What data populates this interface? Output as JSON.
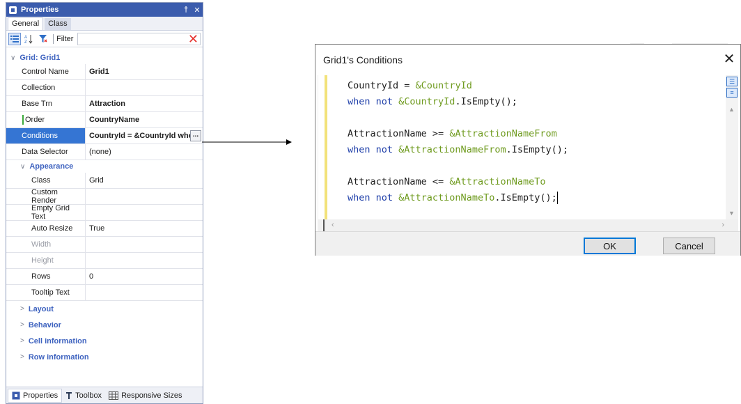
{
  "properties_panel": {
    "title": "Properties",
    "title_buttons": [
      "pin-icon",
      "close-icon"
    ],
    "pin_glyph": "†",
    "close_glyph": "✕",
    "tabs": [
      {
        "label": "General"
      },
      {
        "label": "Class"
      }
    ],
    "filter_label": "Filter",
    "filter_value": "",
    "group_title": "Grid: Grid1",
    "rows": [
      {
        "key": "Control Name",
        "value": "Grid1"
      },
      {
        "key": "Collection",
        "value": ""
      },
      {
        "key": "Base Trn",
        "value": "Attraction"
      },
      {
        "key": "Order",
        "value": "CountryName"
      },
      {
        "key": "Conditions",
        "value": "CountryId = &CountryId whe"
      },
      {
        "key": "Data Selector",
        "value": "(none)"
      }
    ],
    "appearance_title": "Appearance",
    "appearance_rows": [
      {
        "key": "Class",
        "value": "Grid"
      },
      {
        "key": "Custom Render",
        "value": ""
      },
      {
        "key": "Empty Grid Text",
        "value": ""
      },
      {
        "key": "Auto Resize",
        "value": "True"
      },
      {
        "key": "Width",
        "value": ""
      },
      {
        "key": "Height",
        "value": ""
      },
      {
        "key": "Rows",
        "value": "0"
      },
      {
        "key": "Tooltip Text",
        "value": ""
      }
    ],
    "collapsed_sections": [
      "Layout",
      "Behavior",
      "Cell information",
      "Row information"
    ],
    "ellipsis": "...",
    "bottom_tabs": [
      {
        "label": "Properties",
        "icon": "properties-icon"
      },
      {
        "label": "Toolbox",
        "icon": "toolbox-icon"
      },
      {
        "label": "Responsive Sizes",
        "icon": "grid-icon"
      }
    ]
  },
  "dialog": {
    "title": "Grid1's Conditions",
    "close_glyph": "✕",
    "code_lines": [
      [
        {
          "t": "CountryId = ",
          "c": "plain"
        },
        {
          "t": "&CountryId",
          "c": "var"
        }
      ],
      [
        {
          "t": "when not ",
          "c": "kw"
        },
        {
          "t": "&CountryId",
          "c": "var"
        },
        {
          "t": ".IsEmpty();",
          "c": "plain"
        }
      ],
      [],
      [
        {
          "t": "AttractionName >= ",
          "c": "plain"
        },
        {
          "t": "&AttractionNameFrom",
          "c": "var"
        }
      ],
      [
        {
          "t": "when not ",
          "c": "kw"
        },
        {
          "t": "&AttractionNameFrom",
          "c": "var"
        },
        {
          "t": ".IsEmpty();",
          "c": "plain"
        }
      ],
      [],
      [
        {
          "t": "AttractionName <= ",
          "c": "plain"
        },
        {
          "t": "&AttractionNameTo",
          "c": "var"
        }
      ],
      [
        {
          "t": "when not ",
          "c": "kw"
        },
        {
          "t": "&AttractionNameTo",
          "c": "var"
        },
        {
          "t": ".IsEmpty();",
          "c": "plain"
        },
        {
          "t": "",
          "c": "caret"
        }
      ]
    ],
    "ok_label": "OK",
    "cancel_label": "Cancel"
  },
  "colors": {
    "title_bar": "#3b5cad",
    "selection": "#3575d3",
    "section_text": "#3d62bf",
    "keyword": "#1f3fa9",
    "variable": "#6f9b1f",
    "modified_marker": "#3caa3c",
    "error_x": "#e5312d"
  }
}
